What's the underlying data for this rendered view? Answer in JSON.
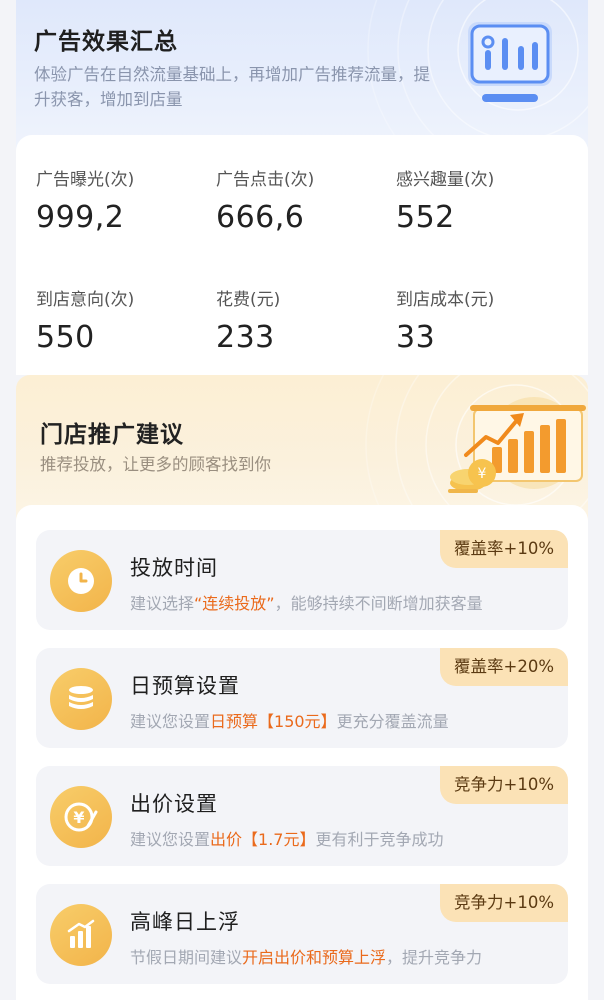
{
  "header": {
    "title": "广告效果汇总",
    "subtitle": "体验广告在自然流量基础上，再增加广告推荐流量，提升获客，增加到店量"
  },
  "stats": [
    {
      "label": "广告曝光(次)",
      "value": "999,2"
    },
    {
      "label": "广告点击(次)",
      "value": "666,6"
    },
    {
      "label": "感兴趣量(次)",
      "value": "552"
    },
    {
      "label": "到店意向(次)",
      "value": "550"
    },
    {
      "label": "花费(元)",
      "value": "233"
    },
    {
      "label": "到店成本(元)",
      "value": "33"
    }
  ],
  "promo": {
    "title": "门店推广建议",
    "subtitle": "推荐投放，让更多的顾客找到你"
  },
  "tips": [
    {
      "icon": "clock-icon",
      "title": "投放时间",
      "badge": "覆盖率+10%",
      "desc_pre": "建议选择",
      "desc_hl": "“连续投放”",
      "desc_post": "，能够持续不间断增加获客量"
    },
    {
      "icon": "coins-icon",
      "title": "日预算设置",
      "badge": "覆盖率+20%",
      "desc_pre": "建议您设置",
      "desc_hl": "日预算【150元】",
      "desc_post": "更充分覆盖流量"
    },
    {
      "icon": "yuan-icon",
      "title": "出价设置",
      "badge": "竞争力+10%",
      "desc_pre": "建议您设置",
      "desc_hl": "出价【1.7元】",
      "desc_post": "更有利于竞争成功"
    },
    {
      "icon": "bar-chart-icon",
      "title": "高峰日上浮",
      "badge": "竞争力+10%",
      "desc_pre": "节假日期间建议",
      "desc_hl": "开启出价和预算上浮",
      "desc_post": "，提升竞争力"
    }
  ],
  "colors": {
    "accent": "#ea6a1c",
    "badge_bg": "#fbe2b6",
    "icon_gold": "#f2b44a",
    "hero_blue": "#dfe8fb"
  }
}
